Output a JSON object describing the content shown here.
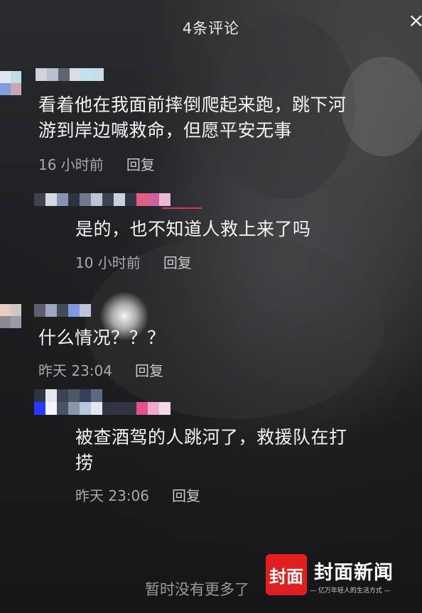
{
  "header": {
    "title": "4条评论",
    "close_label": "×"
  },
  "comments": [
    {
      "text_line1": "看着他在我面前摔倒爬起来跑，跳下河",
      "text_line2": "游到岸边喊救命，但愿平安无事",
      "time": "16 小时前",
      "reply": "回复"
    },
    {
      "text_line1": "是的，也不知道人救上来了吗",
      "time": "10 小时前",
      "reply": "回复"
    },
    {
      "text_line1": "什么情况？？？",
      "time": "昨天 23:04",
      "reply": "回复"
    },
    {
      "text_line1": "被查酒驾的人跳河了，救援队在打",
      "text_line2": "捞",
      "time": "昨天 23:06",
      "reply": "回复"
    }
  ],
  "footer": {
    "no_more": "暂时没有更多了"
  },
  "watermark": {
    "logo_mark": "封面",
    "name": "封面新闻",
    "slogan": "— 亿万年轻人的生活方式 —",
    "brand_color": "#e02020"
  },
  "colors": {
    "text": "#f4f4f4",
    "meta": "#a9a9ad",
    "background": "#1a1a1c"
  }
}
